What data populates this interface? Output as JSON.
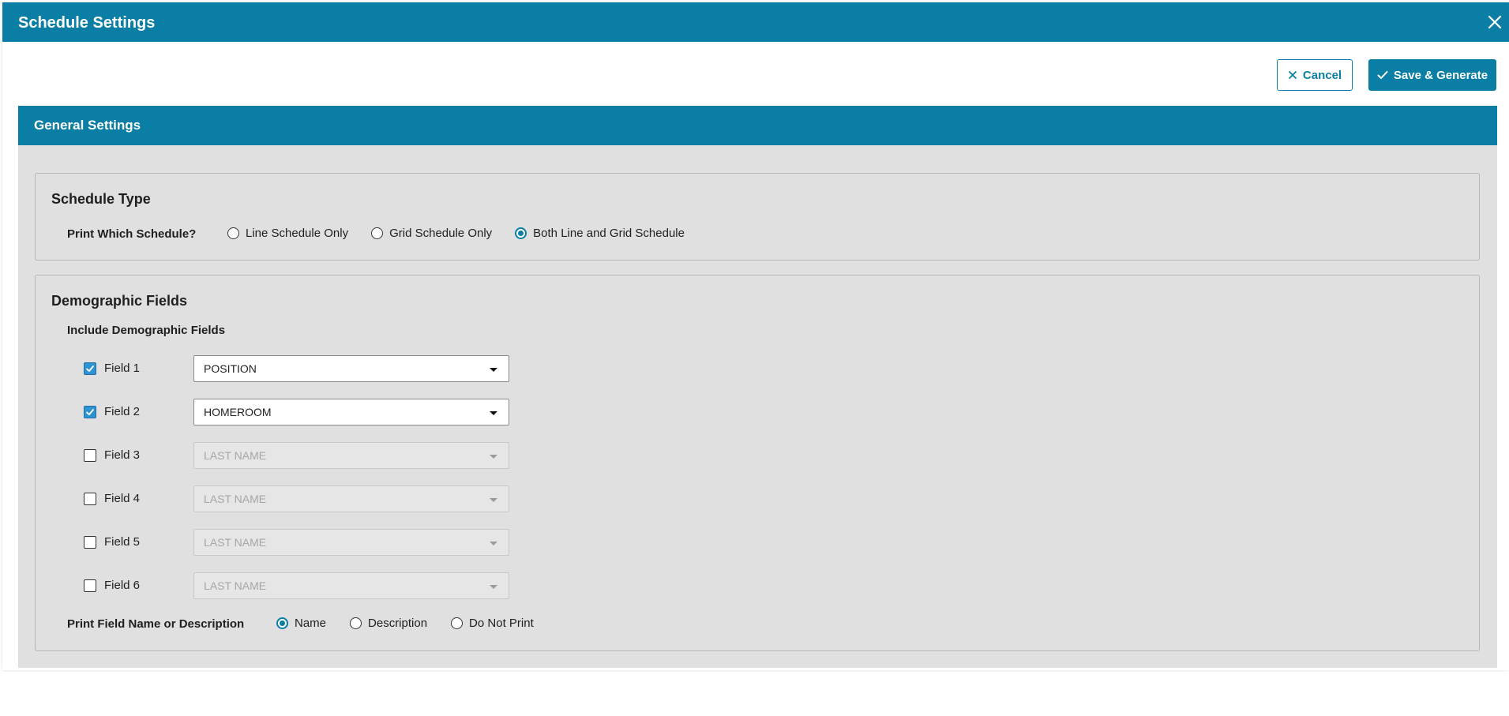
{
  "dialog": {
    "title": "Schedule Settings",
    "close_icon": "close-icon",
    "colors": {
      "accent": "#0a7ea4",
      "panel_bg": "#e0e0e0",
      "checkbox_checked": "#2f93d1"
    }
  },
  "toolbar": {
    "cancel_label": "Cancel",
    "cancel_icon": "x-icon",
    "save_label": "Save & Generate",
    "save_icon": "check-icon"
  },
  "general_settings": {
    "title": "General Settings",
    "schedule_type": {
      "legend": "Schedule Type",
      "question": "Print Which Schedule?",
      "options": [
        {
          "label": "Line Schedule Only",
          "checked": false
        },
        {
          "label": "Grid Schedule Only",
          "checked": false
        },
        {
          "label": "Both Line and Grid Schedule",
          "checked": true
        }
      ]
    },
    "demographic": {
      "legend": "Demographic Fields",
      "subtitle": "Include Demographic Fields",
      "fields": [
        {
          "label": "Field 1",
          "checked": true,
          "value": "POSITION",
          "disabled": false
        },
        {
          "label": "Field 2",
          "checked": true,
          "value": "HOMEROOM",
          "disabled": false
        },
        {
          "label": "Field 3",
          "checked": false,
          "value": "LAST NAME",
          "disabled": true
        },
        {
          "label": "Field 4",
          "checked": false,
          "value": "LAST NAME",
          "disabled": true
        },
        {
          "label": "Field 5",
          "checked": false,
          "value": "LAST NAME",
          "disabled": true
        },
        {
          "label": "Field 6",
          "checked": false,
          "value": "LAST NAME",
          "disabled": true
        }
      ],
      "print_question": "Print Field Name or Description",
      "print_options": [
        {
          "label": "Name",
          "checked": true
        },
        {
          "label": "Description",
          "checked": false
        },
        {
          "label": "Do Not Print",
          "checked": false
        }
      ]
    }
  }
}
